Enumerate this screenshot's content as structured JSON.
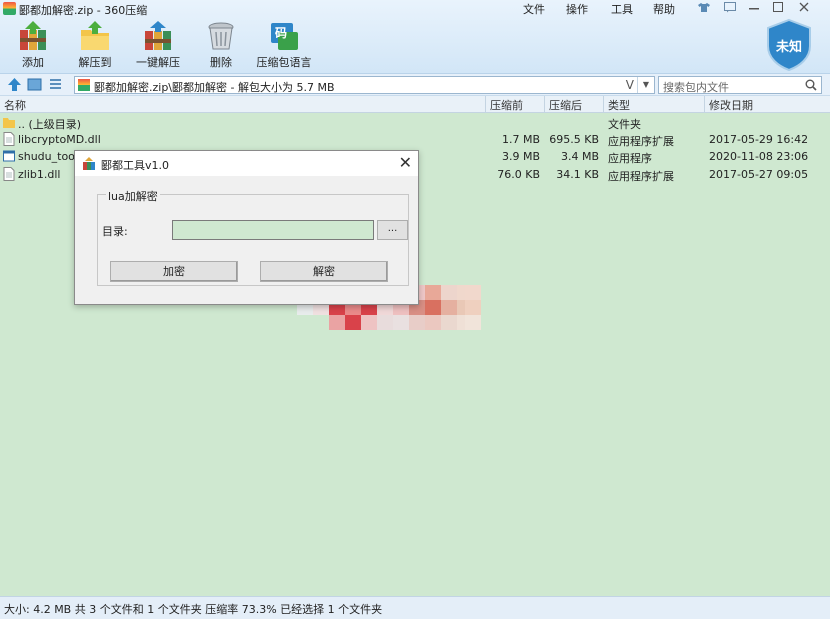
{
  "window": {
    "title": "郾都加解密.zip - 360压缩",
    "menus": [
      "文件",
      "操作",
      "工具",
      "帮助"
    ]
  },
  "toolbar": {
    "items": [
      {
        "label": "添加",
        "icon": "add-books-icon"
      },
      {
        "label": "解压到",
        "icon": "extract-folder-icon"
      },
      {
        "label": "一键解压",
        "icon": "one-click-extract-icon"
      },
      {
        "label": "删除",
        "icon": "trash-icon"
      },
      {
        "label": "压缩包语言",
        "icon": "language-code-icon"
      }
    ],
    "code_glyph": "码",
    "badge_text": "未知"
  },
  "address": {
    "path": "郾都加解密.zip\\郾都加解密 - 解包大小为 5.7 MB",
    "v_glyph": "V"
  },
  "search": {
    "placeholder": "搜索包内文件"
  },
  "columns": [
    "名称",
    "压缩前",
    "压缩后",
    "类型",
    "修改日期"
  ],
  "files": [
    {
      "name": ".. (上级目录)",
      "size": "",
      "packed": "",
      "type": "文件夹",
      "date": "",
      "icon": "folder-icon"
    },
    {
      "name": "libcryptoMD.dll",
      "size": "1.7 MB",
      "packed": "695.5 KB",
      "type": "应用程序扩展",
      "date": "2017-05-29 16:42",
      "icon": "dll-file-icon"
    },
    {
      "name": "shudu_toolv",
      "size": "3.9 MB",
      "packed": "3.4 MB",
      "type": "应用程序",
      "date": "2020-11-08 23:06",
      "icon": "exe-file-icon"
    },
    {
      "name": "zlib1.dll",
      "size": "76.0 KB",
      "packed": "34.1 KB",
      "type": "应用程序扩展",
      "date": "2017-05-27 09:05",
      "icon": "dll-file-icon"
    }
  ],
  "dialog": {
    "title": "郾都工具v1.0",
    "close_glyph": "✕",
    "group_label": "lua加解密",
    "dir_label": "目录:",
    "dir_value": "",
    "browse_label": "...",
    "encrypt_label": "加密",
    "decrypt_label": "解密"
  },
  "status": {
    "text": "大小: 4.2 MB 共 3 个文件和 1 个文件夹 压缩率 73.3% 已经选择 1 个文件夹"
  },
  "colors": {
    "list_bg": "#cfe8d0",
    "toolbar_bg": "#d2e6f7",
    "badge": "#2f86c9"
  }
}
